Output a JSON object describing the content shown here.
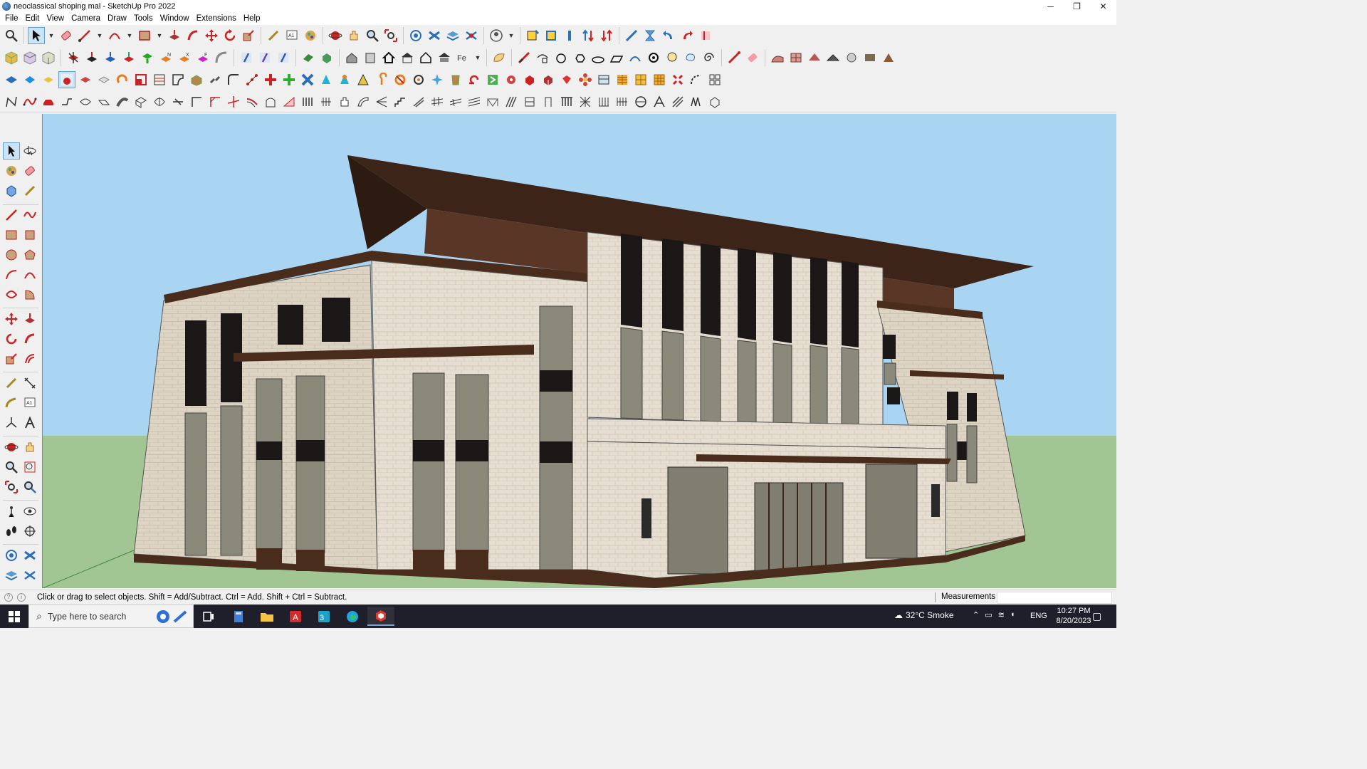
{
  "window": {
    "title": "neoclassical shoping mal - SketchUp Pro 2022",
    "min": "─",
    "restore": "❐",
    "close": "✕"
  },
  "menu": [
    "File",
    "Edit",
    "View",
    "Camera",
    "Draw",
    "Tools",
    "Window",
    "Extensions",
    "Help"
  ],
  "status": {
    "hint": "Click or drag to select objects. Shift = Add/Subtract. Ctrl = Add. Shift + Ctrl = Subtract.",
    "measurements_label": "Measurements",
    "measurements_value": ""
  },
  "taskbar": {
    "search_placeholder": "Type here to search",
    "weather": "32°C  Smoke",
    "lang": "ENG",
    "time": "10:27 PM",
    "date": "8/20/2023"
  },
  "colors": {
    "sky": "#a9d4f2",
    "ground": "#a2c693",
    "stone": "#e6ded0",
    "roof": "#4a2c1c",
    "window": "#1b1717"
  }
}
